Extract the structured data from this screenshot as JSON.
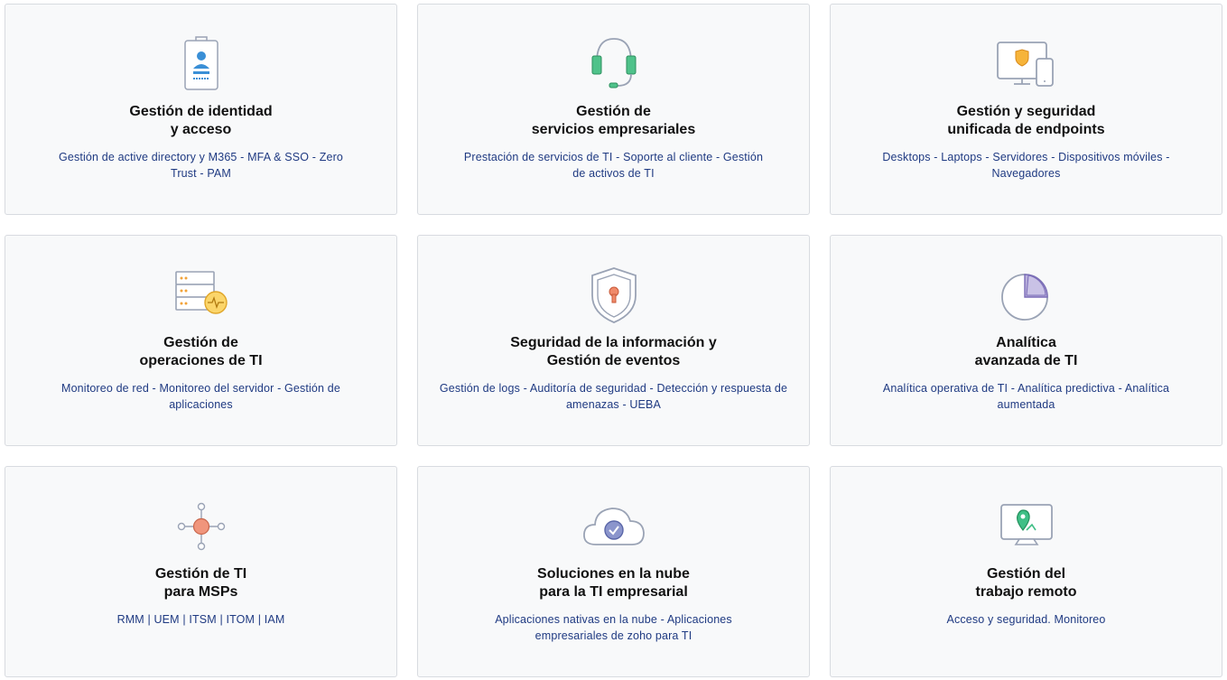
{
  "cards": [
    {
      "title": "Gestión de identidad\ny acceso",
      "desc": "Gestión de active directory y M365 - MFA & SSO - Zero Trust - PAM",
      "icon": "id-badge-icon"
    },
    {
      "title": "Gestión de\nservicios empresariales",
      "desc": "Prestación de servicios de TI - Soporte al cliente - Gestión de activos de TI",
      "icon": "headset-icon"
    },
    {
      "title": "Gestión y seguridad\nunificada de endpoints",
      "desc": "Desktops - Laptops - Servidores - Dispositivos móviles - Navegadores",
      "icon": "devices-icon"
    },
    {
      "title": "Gestión de\noperaciones de TI",
      "desc": "Monitoreo de red - Monitoreo del servidor - Gestión de aplicaciones",
      "icon": "server-monitor-icon"
    },
    {
      "title": "Seguridad de la información y\nGestión de eventos",
      "desc": "Gestión de logs - Auditoría de seguridad - Detección y respuesta de amenazas - UEBA",
      "icon": "shield-lock-icon"
    },
    {
      "title": "Analítica\navanzada de TI",
      "desc": "Analítica operativa de TI - Analítica predictiva - Analítica aumentada",
      "icon": "pie-chart-icon"
    },
    {
      "title": "Gestión de TI\npara MSPs",
      "desc": "RMM | UEM | ITSM | ITOM | IAM",
      "icon": "network-node-icon"
    },
    {
      "title": "Soluciones en la nube\npara la TI empresarial",
      "desc": "Aplicaciones nativas en la nube - Aplicaciones empresariales de zoho para TI",
      "icon": "cloud-check-icon"
    },
    {
      "title": "Gestión del\ntrabajo remoto",
      "desc": "Acceso y seguridad. Monitoreo",
      "icon": "remote-location-icon"
    }
  ]
}
